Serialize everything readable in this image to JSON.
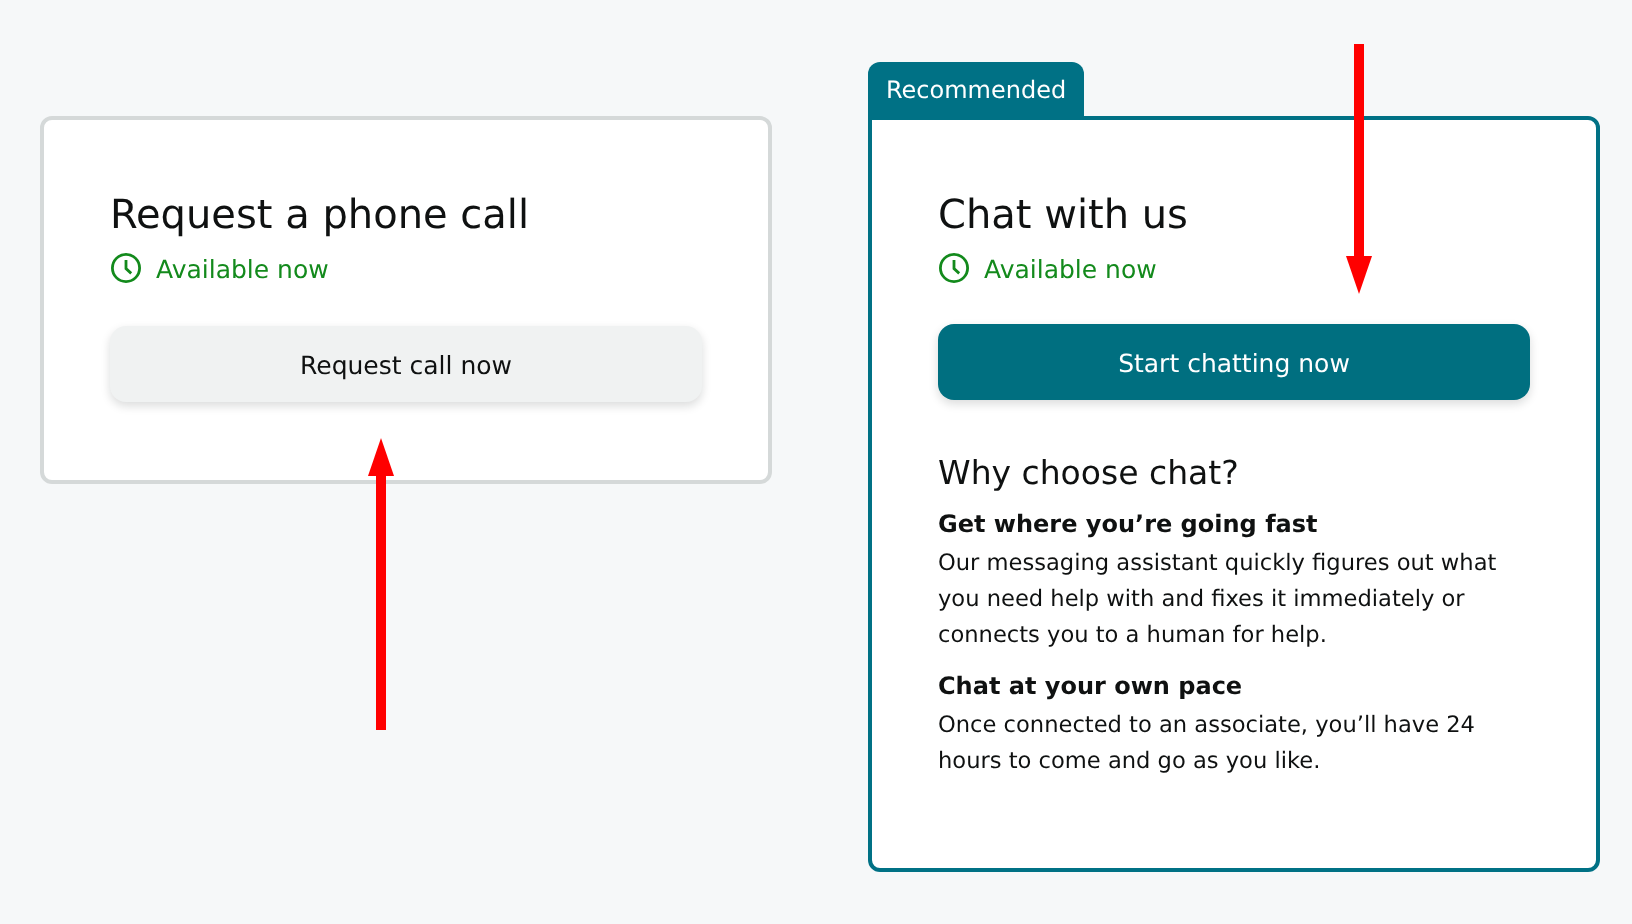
{
  "phone_card": {
    "title": "Request a phone call",
    "availability": "Available now",
    "button": "Request call now"
  },
  "chat_card": {
    "badge": "Recommended",
    "title": "Chat with us",
    "availability": "Available now",
    "button": "Start chatting now",
    "why_title": "Why choose chat?",
    "reasons": [
      {
        "heading": "Get where you’re going fast",
        "text": "Our messaging assistant quickly figures out what you need help with and fixes it immediately or connects you to a human for help."
      },
      {
        "heading": "Chat at your own pace",
        "text": "Once connected to an associate, you’ll have 24 hours to come and go as you like."
      }
    ]
  }
}
